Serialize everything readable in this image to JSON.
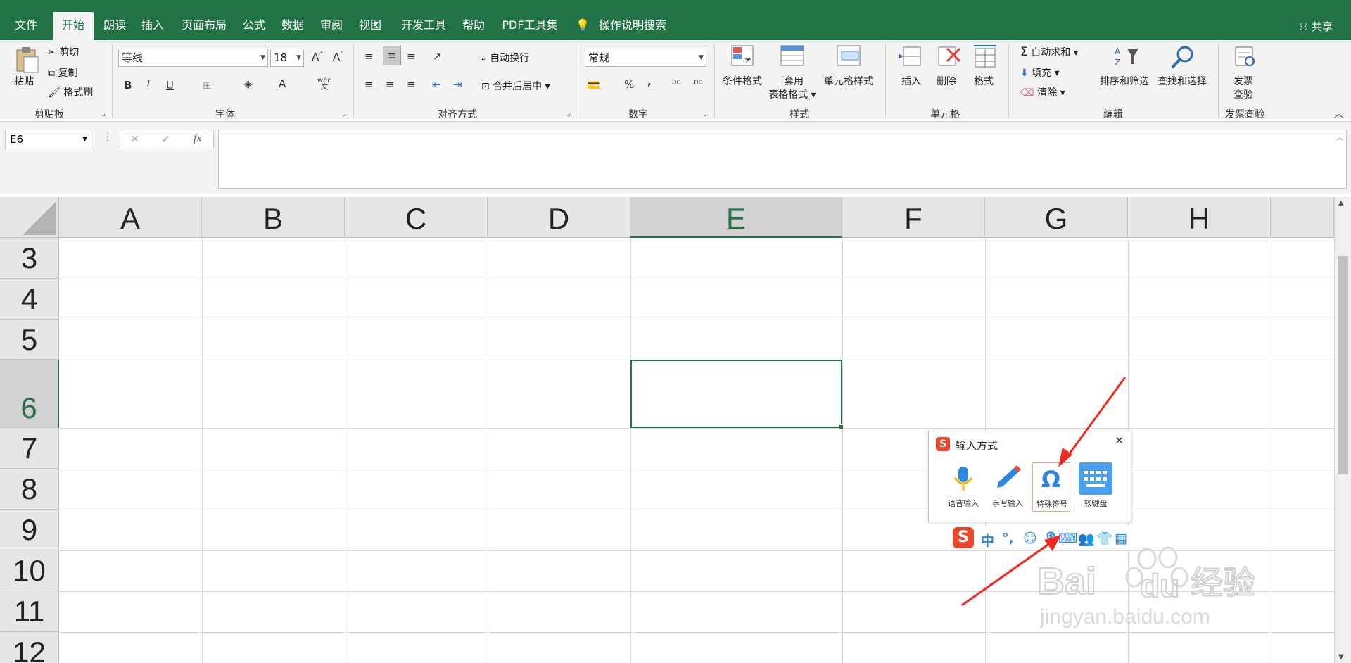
{
  "app": {
    "accent": "#217346"
  },
  "tabs": [
    "文件",
    "开始",
    "朗读",
    "插入",
    "页面布局",
    "公式",
    "数据",
    "审阅",
    "视图",
    "开发工具",
    "帮助",
    "PDF工具集"
  ],
  "active_tab": "开始",
  "search_label": "操作说明搜索",
  "share_label": "共享",
  "ribbon": {
    "clipboard": {
      "paste": "粘贴",
      "cut": "剪切",
      "copy": "复制",
      "format_painter": "格式刷",
      "label": "剪贴板"
    },
    "font": {
      "name": "等线",
      "size": "18",
      "label": "字体",
      "bold": "B",
      "italic": "I",
      "underline": "U",
      "font_color": "A",
      "phonetic": "wén\n文"
    },
    "alignment": {
      "wrap": "自动换行",
      "merge": "合并后居中",
      "label": "对齐方式"
    },
    "number": {
      "format": "常规",
      "percent": "%",
      "comma": ",",
      "inc_decimal": ".00",
      "dec_decimal": ".00",
      "label": "数字"
    },
    "styles": {
      "conditional": "条件格式",
      "table_format_1": "套用",
      "table_format_2": "表格格式",
      "cell_styles": "单元格样式",
      "label": "样式"
    },
    "cells": {
      "insert": "插入",
      "delete": "删除",
      "format": "格式",
      "label": "单元格"
    },
    "editing": {
      "autosum": "自动求和",
      "fill": "填充",
      "clear": "清除",
      "sort": "排序和筛选",
      "find": "查找和选择",
      "label": "编辑"
    },
    "invoice": {
      "btn_1": "发票",
      "btn_2": "查验",
      "label": "发票查验"
    }
  },
  "formula_bar": {
    "name_box": "E6",
    "fx": "fx",
    "cancel": "✕",
    "enter": "✓",
    "content": ""
  },
  "sheet": {
    "columns": [
      "A",
      "B",
      "C",
      "D",
      "E",
      "F",
      "G",
      "H"
    ],
    "rows": [
      "3",
      "4",
      "5",
      "6",
      "7",
      "8",
      "9",
      "10",
      "11",
      "12"
    ],
    "selected_cell": "E6"
  },
  "ime_popup": {
    "title": "输入方式",
    "close": "✕",
    "tools": [
      {
        "label": "语音输入",
        "icon": "microphone-icon"
      },
      {
        "label": "手写输入",
        "icon": "pen-icon"
      },
      {
        "label": "特殊符号",
        "icon": "omega-icon"
      },
      {
        "label": "软键盘",
        "icon": "keyboard-icon"
      }
    ],
    "toolbar": {
      "logo": "S",
      "lang": "中",
      "punct": "°,"
    }
  },
  "watermark": {
    "brand_1": "Bai",
    "brand_2": "du",
    "brand_3": "经验",
    "url": "jingyan.baidu.com"
  }
}
